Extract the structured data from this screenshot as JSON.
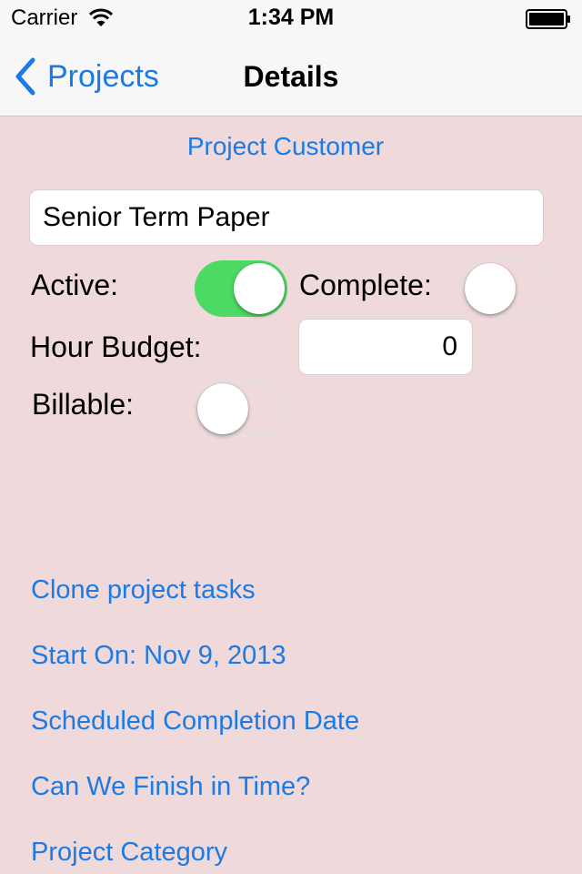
{
  "status_bar": {
    "carrier": "Carrier",
    "time": "1:34 PM",
    "wifi_icon": "wifi-icon",
    "battery_icon": "battery-full-icon"
  },
  "nav": {
    "back_label": "Projects",
    "back_icon": "chevron-left-icon",
    "title": "Details"
  },
  "form": {
    "customer_link": "Project Customer",
    "project_name": "Senior Term Paper",
    "active_label": "Active:",
    "active_on": true,
    "complete_label": "Complete:",
    "complete_on": false,
    "hour_budget_label": "Hour Budget:",
    "hour_budget_value": "0",
    "billable_label": "Billable:",
    "billable_on": false
  },
  "links": {
    "clone_tasks": "Clone project tasks",
    "start_on": "Start On: Nov 9, 2013",
    "scheduled_completion": "Scheduled Completion Date",
    "finish_in_time": "Can We Finish in Time?",
    "project_category": "Project Category"
  },
  "colors": {
    "background": "#f0d9db",
    "accent": "#1a7ae6",
    "switch_on": "#4cd964"
  }
}
